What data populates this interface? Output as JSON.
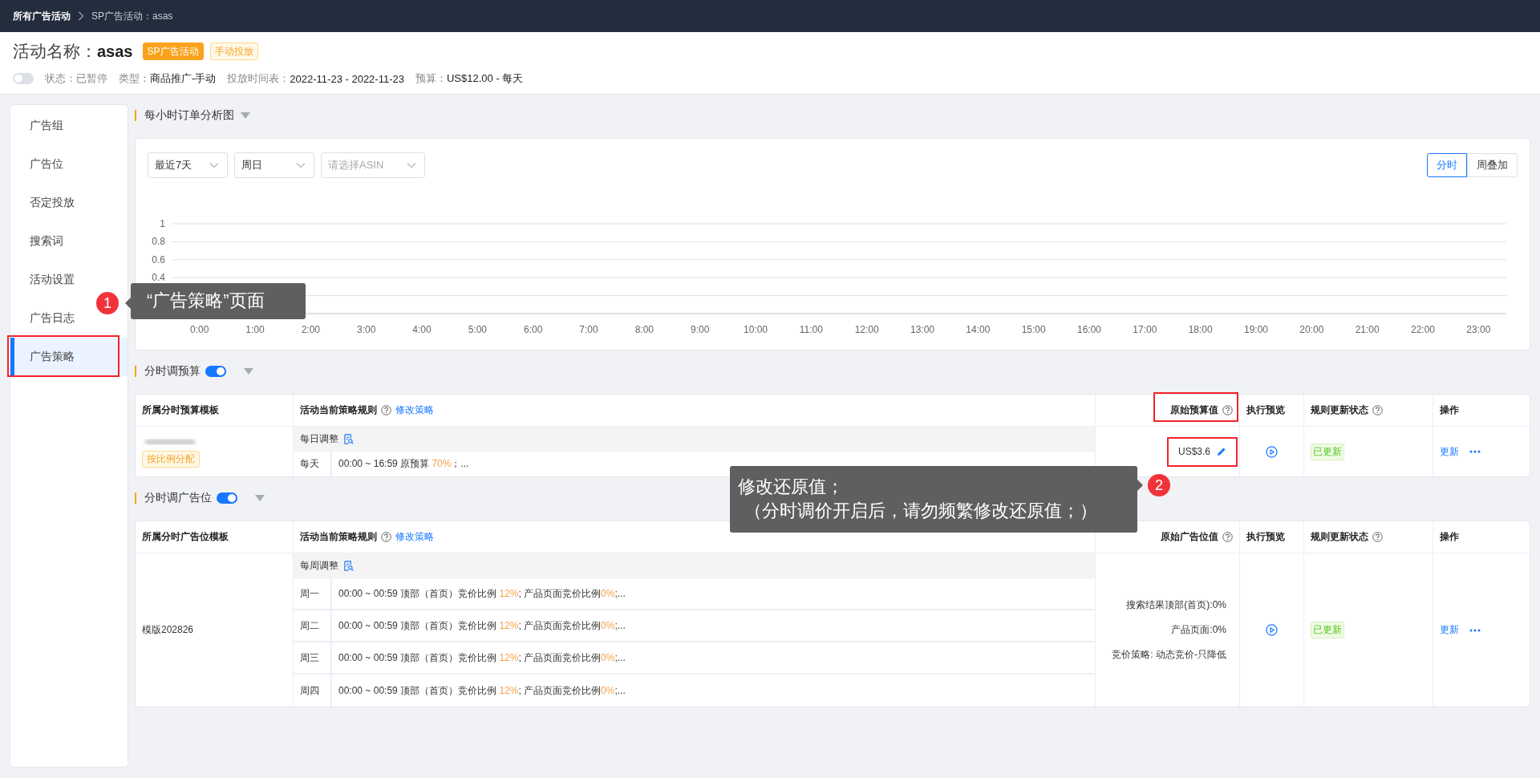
{
  "breadcrumb": [
    {
      "label": "所有广告活动",
      "current": false
    },
    {
      "label": "SP广告活动：asas",
      "current": true
    }
  ],
  "campaign": {
    "label": "活动名称：",
    "name": "asas",
    "badges": [
      {
        "label": "SP广告活动",
        "kind": "solid"
      },
      {
        "label": "手动投放",
        "kind": "outline"
      }
    ],
    "status": {
      "on": false,
      "label": "状态：",
      "value": "已暂停"
    },
    "meta": [
      {
        "label": "类型：",
        "value": "商品推广-手动"
      },
      {
        "label": "投放时间表：",
        "value": "2022-11-23 - 2022-11-23"
      },
      {
        "label": "预算：",
        "value": "US$12.00 - 每天"
      }
    ]
  },
  "sidebar": {
    "items": [
      {
        "label": "广告组",
        "selected": false,
        "highlighted": false
      },
      {
        "label": "广告位",
        "selected": false,
        "highlighted": false
      },
      {
        "label": "否定投放",
        "selected": false,
        "highlighted": false
      },
      {
        "label": "搜索词",
        "selected": false,
        "highlighted": false
      },
      {
        "label": "活动设置",
        "selected": false,
        "highlighted": false
      },
      {
        "label": "广告日志",
        "selected": false,
        "highlighted": false
      },
      {
        "label": "广告策略",
        "selected": true,
        "highlighted": true
      }
    ]
  },
  "hourly_chart": {
    "title": "每小时订单分析图",
    "filters": [
      {
        "value": "最近7天"
      },
      {
        "value": "周日"
      },
      {
        "placeholder": "请选择ASIN"
      }
    ],
    "view_toggle": [
      {
        "label": "分时",
        "selected": true
      },
      {
        "label": "周叠加",
        "selected": false
      }
    ],
    "chart_data": {
      "type": "line",
      "categories": [
        "0:00",
        "1:00",
        "2:00",
        "3:00",
        "4:00",
        "5:00",
        "6:00",
        "7:00",
        "8:00",
        "9:00",
        "10:00",
        "11:00",
        "12:00",
        "13:00",
        "14:00",
        "15:00",
        "16:00",
        "17:00",
        "18:00",
        "19:00",
        "20:00",
        "21:00",
        "22:00",
        "23:00"
      ],
      "ylim": [
        0,
        1
      ],
      "yticks": [
        0.4,
        0.6,
        0.8,
        1
      ],
      "grid": true
    }
  },
  "sections": [
    {
      "title": "分时调预算",
      "on": true,
      "columns": [
        {
          "label": "所属分时预算模板",
          "help": false,
          "highlighted": false
        },
        {
          "label": "活动当前策略规则",
          "help": true,
          "link": "修改策略",
          "highlighted": false
        },
        {
          "label": "原始预算值",
          "help": true,
          "highlighted": true
        },
        {
          "label": "执行预览",
          "help": false,
          "highlighted": false
        },
        {
          "label": "规则更新状态",
          "help": true,
          "highlighted": false
        },
        {
          "label": "操作",
          "help": false,
          "highlighted": false
        }
      ],
      "rows": [
        {
          "template": {
            "redacted": true,
            "badge": "按比例分配"
          },
          "schedule": {
            "title": "每日调整",
            "rows": [
              {
                "day": "每天",
                "rule": [
                  {
                    "text": "00:00 ~ 16:59 原预算 ",
                    "highlight": false
                  },
                  {
                    "text": "70%",
                    "highlight": true
                  },
                  {
                    "text": "；...",
                    "highlight": false
                  }
                ]
              }
            ]
          },
          "original": {
            "lines": [
              "US$3.6"
            ],
            "editable": true,
            "highlighted": true
          },
          "status": {
            "text": "已更新",
            "kind": "success"
          },
          "action": "更新"
        }
      ]
    },
    {
      "title": "分时调广告位",
      "on": true,
      "columns": [
        {
          "label": "所属分时广告位模板",
          "help": false,
          "highlighted": false
        },
        {
          "label": "活动当前策略规则",
          "help": true,
          "link": "修改策略",
          "highlighted": false
        },
        {
          "label": "原始广告位值",
          "help": true,
          "highlighted": false
        },
        {
          "label": "执行预览",
          "help": false,
          "highlighted": false
        },
        {
          "label": "规则更新状态",
          "help": true,
          "highlighted": false
        },
        {
          "label": "操作",
          "help": false,
          "highlighted": false
        }
      ],
      "rows": [
        {
          "template": {
            "name": "模版202826"
          },
          "schedule": {
            "title": "每周调整",
            "rows": [
              {
                "day": "周一",
                "rule": [
                  {
                    "text": "00:00 ~ 00:59 顶部（首页）竞价比例 ",
                    "highlight": false
                  },
                  {
                    "text": "12%",
                    "highlight": true
                  },
                  {
                    "text": "; 产品页面竞价比例",
                    "highlight": false
                  },
                  {
                    "text": "0%",
                    "highlight": true
                  },
                  {
                    "text": ";...",
                    "highlight": false
                  }
                ]
              },
              {
                "day": "周二",
                "rule": [
                  {
                    "text": "00:00 ~ 00:59 顶部（首页）竞价比例 ",
                    "highlight": false
                  },
                  {
                    "text": "12%",
                    "highlight": true
                  },
                  {
                    "text": "; 产品页面竞价比例",
                    "highlight": false
                  },
                  {
                    "text": "0%",
                    "highlight": true
                  },
                  {
                    "text": ";...",
                    "highlight": false
                  }
                ]
              },
              {
                "day": "周三",
                "rule": [
                  {
                    "text": "00:00 ~ 00:59 顶部（首页）竞价比例 ",
                    "highlight": false
                  },
                  {
                    "text": "12%",
                    "highlight": true
                  },
                  {
                    "text": "; 产品页面竞价比例",
                    "highlight": false
                  },
                  {
                    "text": "0%",
                    "highlight": true
                  },
                  {
                    "text": ";...",
                    "highlight": false
                  }
                ]
              },
              {
                "day": "周四",
                "rule": [
                  {
                    "text": "00:00 ~ 00:59 顶部（首页）竞价比例 ",
                    "highlight": false
                  },
                  {
                    "text": "12%",
                    "highlight": true
                  },
                  {
                    "text": "; 产品页面竞价比例",
                    "highlight": false
                  },
                  {
                    "text": "0%",
                    "highlight": true
                  },
                  {
                    "text": ";...",
                    "highlight": false
                  }
                ]
              }
            ]
          },
          "original": {
            "lines": [
              "搜索结果顶部(首页):0%",
              "产品页面:0%",
              "竞价策略: 动态竞价-只降低"
            ],
            "editable": false,
            "highlighted": false
          },
          "status": {
            "text": "已更新",
            "kind": "success"
          },
          "action": "更新"
        }
      ]
    }
  ],
  "callouts": [
    {
      "number": "1",
      "text": "“广告策略”页面"
    },
    {
      "number": "2",
      "lines": [
        "修改还原值；",
        "（分时调价开启后，请勿频繁修改还原值；）"
      ]
    }
  ]
}
